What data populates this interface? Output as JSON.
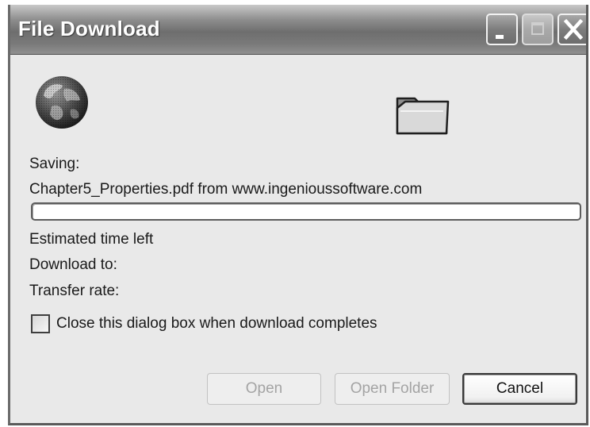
{
  "window": {
    "title": "File Download",
    "controls": {
      "minimize": "minimize-icon",
      "maximize": "maximize-icon",
      "close": "close-icon"
    }
  },
  "icons": {
    "source": "globe-icon",
    "destination": "folder-icon"
  },
  "download": {
    "saving_label": "Saving:",
    "file_line": "Chapter5_Properties.pdf from www.ingenioussoftware.com",
    "progress": 0,
    "estimated_time_label": "Estimated time left",
    "download_to_label": "Download to:",
    "transfer_rate_label": "Transfer rate:"
  },
  "options": {
    "close_on_complete_label": "Close this dialog box when download completes",
    "close_on_complete_checked": false
  },
  "buttons": {
    "open": "Open",
    "open_folder": "Open Folder",
    "cancel": "Cancel"
  },
  "colors": {
    "titlebar": "#7a7a7a",
    "window_bg": "#e9e9e9",
    "disabled_text": "#a4a4a4"
  }
}
